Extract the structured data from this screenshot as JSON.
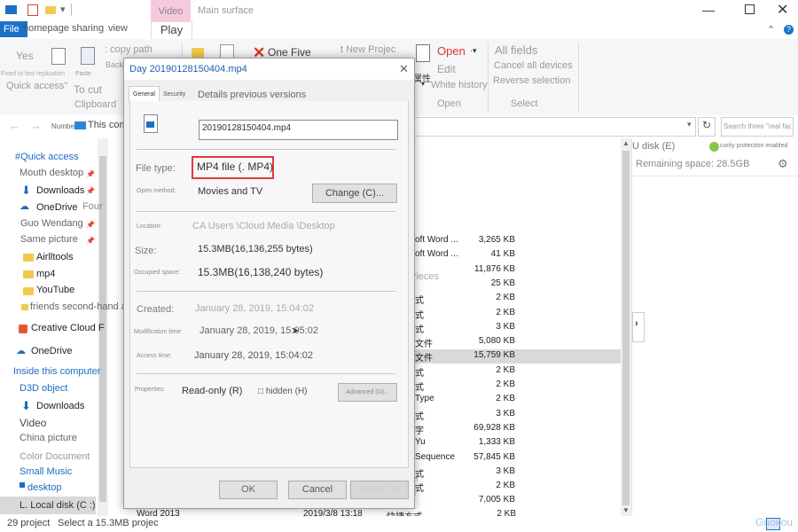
{
  "titlebar": {
    "video_tools": "Video tools",
    "main_surface": "Main surface"
  },
  "tabs": {
    "file": "File",
    "homepage": "homepage",
    "sharing": "sharing",
    "view": "view",
    "play": "Play"
  },
  "ribbon": {
    "yes": "Yes",
    "fixed_quick": "Fixed to fast replication",
    "quick_access": "Quick access\"",
    "paste": "Paste",
    "to_cut": "To cut",
    "clipboard": "Clipboard",
    "copy_path": ": copy path",
    "back": "Back",
    "one_five": "One Five",
    "new_project": "t New Projec",
    "attr": "属性",
    "open": "Open",
    "edit": "Edit",
    "history": "White history",
    "open_group": "Open",
    "all_fields": "All fields",
    "cancel_all": "Cancel all devices",
    "reverse": "Reverse selection",
    "select_group": "Select"
  },
  "address": {
    "number": "Number",
    "this_computer": "This computer",
    "search_placeholder": "Search three \"real faces"
  },
  "nav": {
    "quick_access": "#Quick access",
    "mouth_desktop": "Mouth desktop",
    "downloads": "Downloads",
    "onedrive": "OneDrive",
    "four": "Four",
    "guo": "Guo Wendang",
    "same_picture": "Same picture",
    "airltools": "Airlltools",
    "mp4": "mp4",
    "youtube": "YouTube",
    "friends": "friends second-hand all",
    "creative_cloud": "Creative Cloud F",
    "onedrive2": "OneDrive",
    "inside": "Inside this computer",
    "d3d": "D3D object",
    "downloads2": "Downloads",
    "video": "Video",
    "china_picture": "China picture",
    "color_document": "Color Document",
    "small_music": "Small Music",
    "desktop": "desktop",
    "local_disk": "L. Local disk (C :)"
  },
  "right_panel": {
    "u_disk": "U disk (E)",
    "security": "curity protection enabled",
    "remaining": "Remaining space: 28.5GB"
  },
  "list": {
    "partial_names": [
      "oft Word ...",
      "oft Word ...",
      "",
      "",
      "式",
      "式",
      "式",
      "文件",
      "文件",
      "式",
      "式",
      "Type",
      "式",
      "字",
      "Yu",
      "Sequence",
      "式",
      "式",
      ""
    ],
    "pieces": "Pieces",
    "sizes": [
      "3,265 KB",
      "41 KB",
      "11,876 KB",
      "25 KB",
      "2 KB",
      "2 KB",
      "3 KB",
      "5,080 KB",
      "15,759 KB",
      "2 KB",
      "2 KB",
      "2 KB",
      "3 KB",
      "69,928 KB",
      "1,333 KB",
      "57,845 KB",
      "3 KB",
      "2 KB",
      "7,005 KB"
    ],
    "last_row_name": "Word 2013",
    "last_row_date": "2019/3/8 13:18",
    "last_row_type": "快捷方式",
    "last_row_size": "2 KB",
    "type_overlay": "Type"
  },
  "status": {
    "count": "29 project",
    "select": "Select a 15.3MB projec"
  },
  "watermark": "Guokou",
  "dialog": {
    "title": "Day 20190128150404.mp4",
    "tabs": {
      "general": "General",
      "security": "Security",
      "details": "Details previous versions"
    },
    "filename": "20190128150404.mp4",
    "file_type_label": "File type:",
    "file_type_value": "MP4 file (. MP4)",
    "open_method_label": "Open method:",
    "open_method_value": "Movies and TV",
    "change_button": "Change (C)...",
    "location_label": "Location:",
    "location_value": "CA Users \\Cloud Media \\Desktop",
    "size_label": "Size:",
    "size_value": "15.3MB(16,136,255 bytes)",
    "occupied_label": "Occupied space:",
    "occupied_value": "15.3MB(16,138,240 bytes)",
    "created_label": "Created:",
    "created_value": "January 28, 2019, 15:04:02",
    "modified_label": "Modification time:",
    "modified_value": "January 28, 2019, 15:05:02",
    "access_label": "Access time:",
    "access_value": "January 28, 2019, 15:04:02",
    "properties_label": "Properties:",
    "readonly": "Read-only (R)",
    "hidden": "□ hidden (H)",
    "advanced": "Advanced (D)...",
    "ok": "OK",
    "cancel": "Cancel",
    "apply": "Apply (A)"
  },
  "colors": {
    "accent_blue": "#1a73c8",
    "highlight_red": "#e23b3b",
    "ribbon_bg": "#f5f6f7"
  }
}
